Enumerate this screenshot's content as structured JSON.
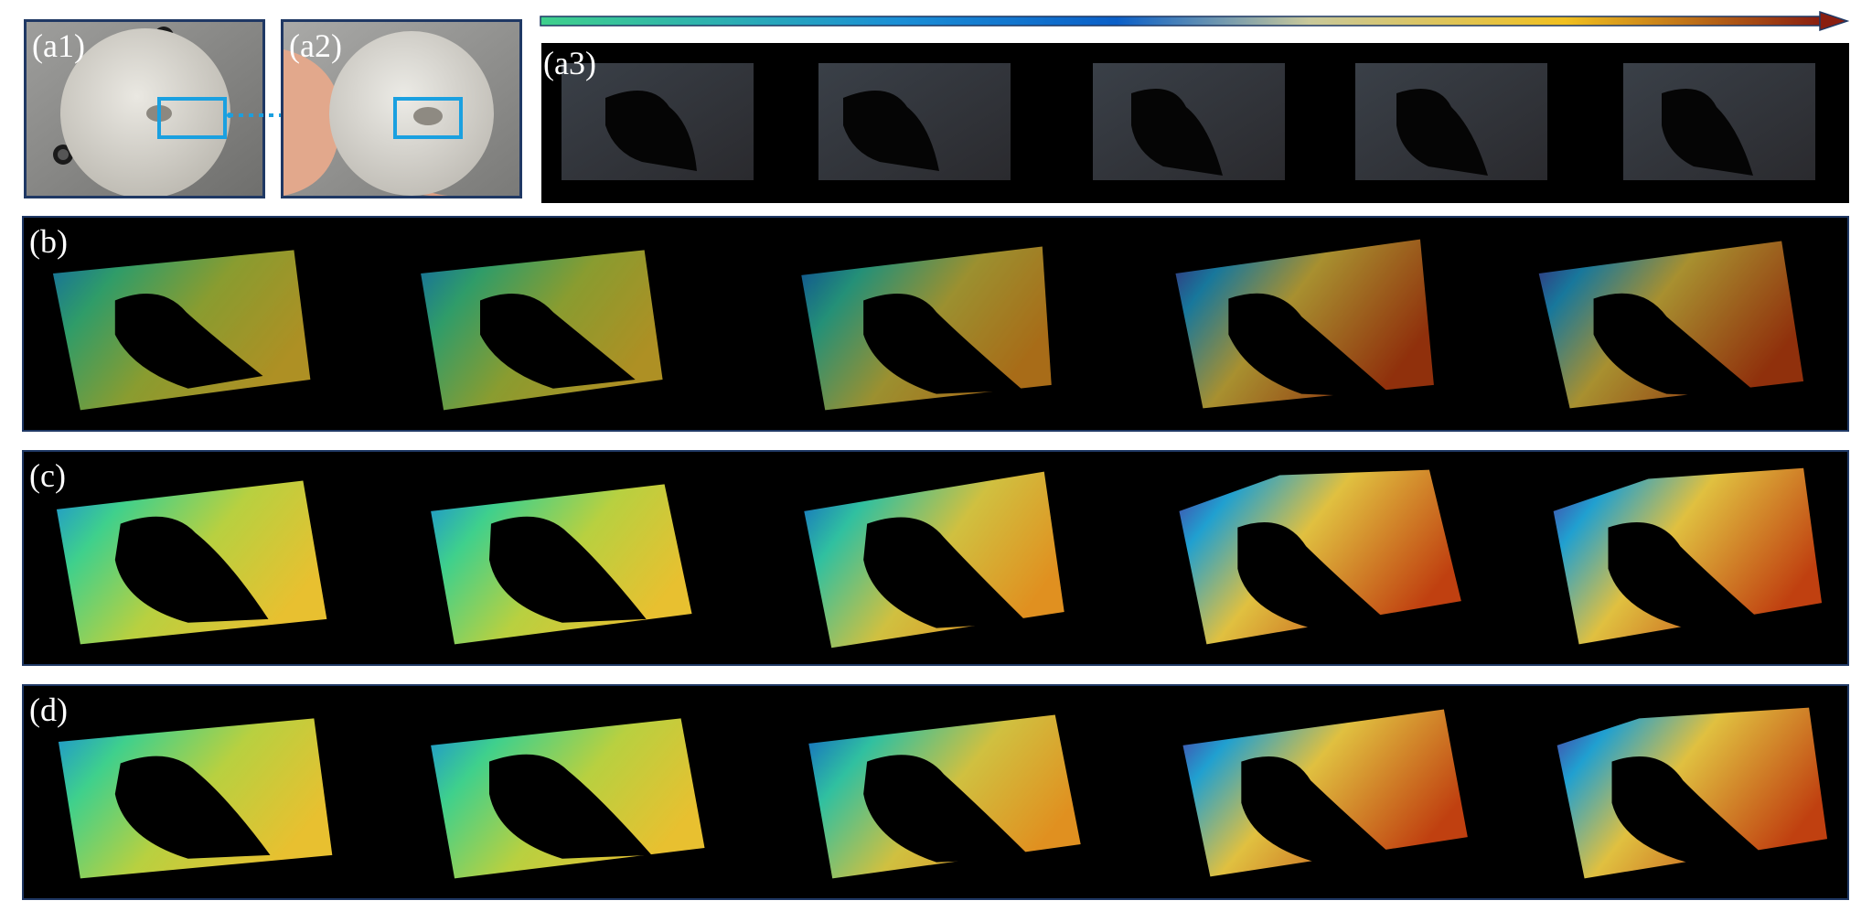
{
  "panels": {
    "a1": "(a1)",
    "a2": "(a2)",
    "a3": "(a3)",
    "b": "(b)",
    "c": "(c)",
    "d": "(d)"
  },
  "colors": {
    "panel_border": "#1f3864",
    "highlight_box": "#1aa0e0",
    "colormap": [
      "#3fd08c",
      "#1a8fd6",
      "#0a5fc8",
      "#c8c89a",
      "#f0c020",
      "#c85010",
      "#8a1e10"
    ]
  },
  "frames_per_row": 5
}
